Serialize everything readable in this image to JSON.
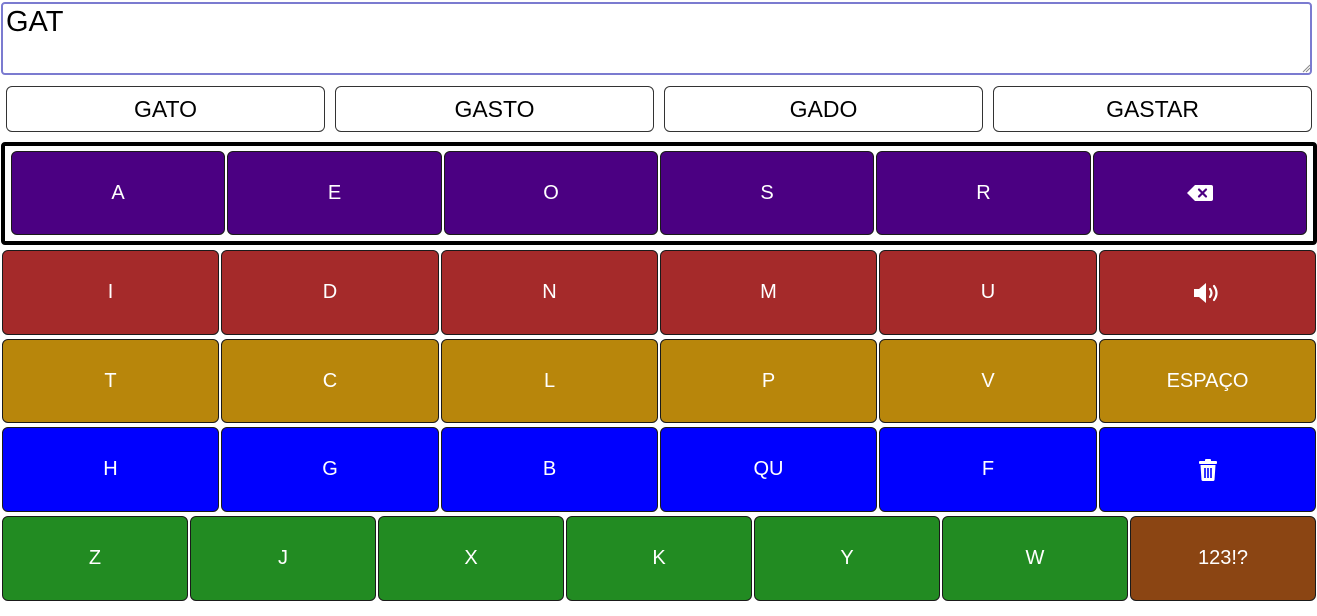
{
  "text_input": {
    "value": "GAT"
  },
  "suggestions": [
    "GATO",
    "GASTO",
    "GADO",
    "GASTAR"
  ],
  "colors": {
    "row1": "#4b0082",
    "row2": "#a52a2a",
    "row3": "#b8860b",
    "row4": "#0000ff",
    "row5": "#228b22",
    "numbers_key": "#8b4513",
    "scan_highlight": "#000000"
  },
  "keyboard": {
    "row1": [
      "A",
      "E",
      "O",
      "S",
      "R"
    ],
    "row1_last_icon": "backspace-icon",
    "row2": [
      "I",
      "D",
      "N",
      "M",
      "U"
    ],
    "row2_last_icon": "speaker-icon",
    "row3": [
      "T",
      "C",
      "L",
      "P",
      "V",
      "ESPAÇO"
    ],
    "row4": [
      "H",
      "G",
      "B",
      "QU",
      "F"
    ],
    "row4_last_icon": "trash-icon",
    "row5": [
      "Z",
      "J",
      "X",
      "K",
      "Y",
      "W",
      "123!?"
    ]
  }
}
